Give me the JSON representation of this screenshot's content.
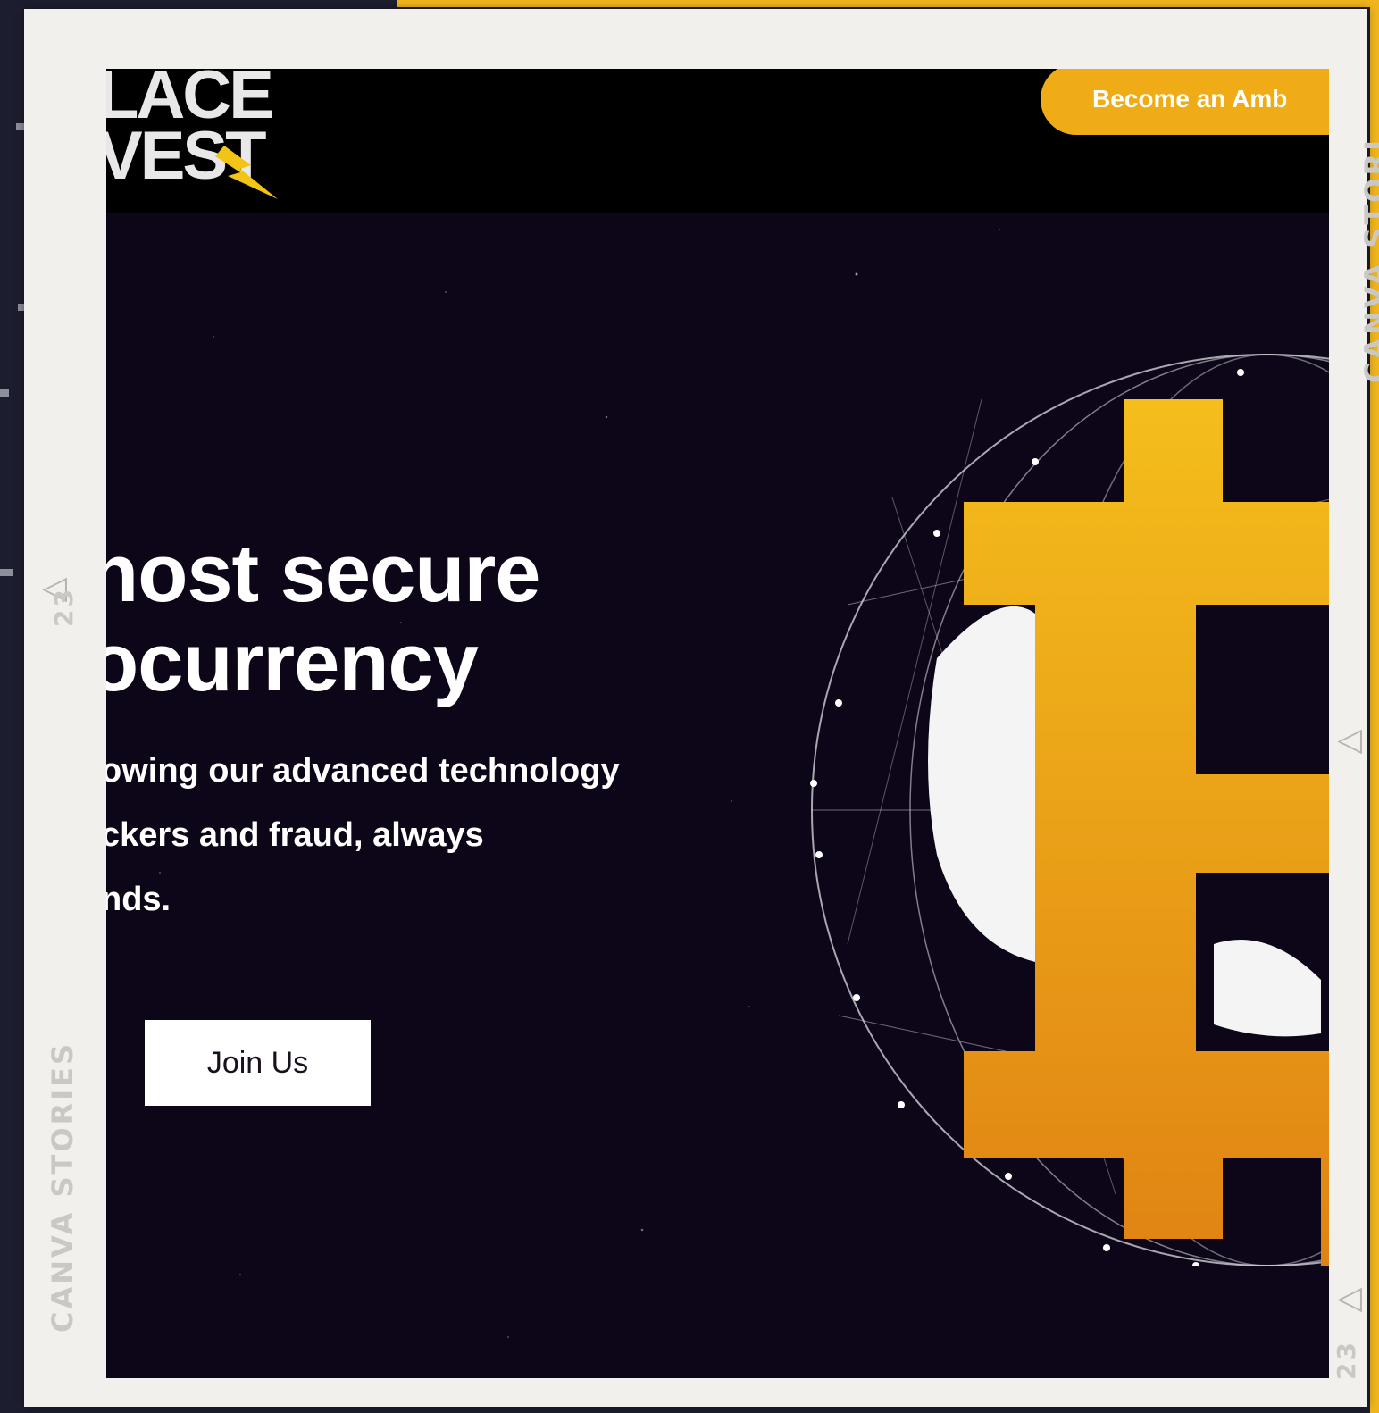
{
  "frame": {
    "caption_right": "CANVA STORI",
    "caption_left": "CANVA STORIES",
    "frame_number_left": "23",
    "frame_number_right": "23",
    "triangle": "△"
  },
  "site": {
    "logo_line1": "LACE",
    "logo_line2": "VEST",
    "ambassador_button": "Become an Amb",
    "hero_title_line1": "nost secure",
    "hero_title_line2": "ocurrency",
    "hero_sub_line1": "owing our advanced technology",
    "hero_sub_line2": "ckers and fraud, always",
    "hero_sub_line3": "nds.",
    "join_button": "Join Us"
  },
  "colors": {
    "accent": "#efac16",
    "background": "#0d0618",
    "frame": "#f1f0ec"
  },
  "icons": {
    "logo_bolt": "lightning-bolt-icon",
    "hero_graphic": "bitcoin-globe-icon"
  }
}
